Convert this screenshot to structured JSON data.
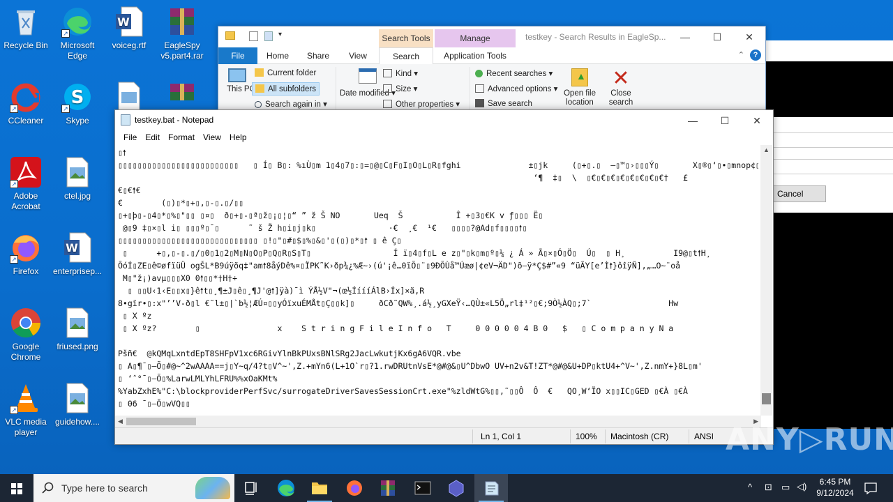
{
  "desktop_icons": [
    {
      "label": "Recycle Bin"
    },
    {
      "label": "Microsoft Edge"
    },
    {
      "label": "voiceg.rtf"
    },
    {
      "label": "EagleSpy v5.part4.rar"
    },
    {
      "label": "CCleaner"
    },
    {
      "label": "Skype"
    },
    {
      "label": "Adobe Acrobat"
    },
    {
      "label": "ctel.jpg"
    },
    {
      "label": "Firefox"
    },
    {
      "label": "enterprisep..."
    },
    {
      "label": "Google Chrome"
    },
    {
      "label": "friused.png"
    },
    {
      "label": "VLC media player"
    },
    {
      "label": "guidehow...."
    }
  ],
  "explorer": {
    "title": "testkey - Search Results in EagleSp...",
    "ctx_search_tools": "Search Tools",
    "ctx_manage": "Manage",
    "tabs": {
      "file": "File",
      "home": "Home",
      "share": "Share",
      "view": "View",
      "search": "Search",
      "app_tools": "Application Tools"
    },
    "ribbon": {
      "this_pc": "This PC",
      "current_folder": "Current folder",
      "all_subfolders": "All subfolders",
      "search_again_in": "Search again in",
      "date_modified": "Date modified",
      "kind": "Kind",
      "size": "Size",
      "other_properties": "Other properties",
      "recent_searches": "Recent searches",
      "advanced_options": "Advanced options",
      "save_search": "Save search",
      "open_file_location": "Open file location",
      "close_search": "Close search"
    }
  },
  "dialog": {
    "cancel": "Cancel"
  },
  "notepad": {
    "title": "testkey.bat - Notepad",
    "menu": [
      "File",
      "Edit",
      "Format",
      "View",
      "Help"
    ],
    "lines": [
      "▯🠕",
      "▯▯▯▯▯▯▯▯▯▯▯▯▯▯▯▯▯▯▯▯▯▯▯▯▯   ▯ Í▯ B▯: %ıÙ▯m 1▯4▯7▯:▯=▯@▯C▯F▯I▯O▯L▯R▯fghi              ±▯jk     (▯+▯.▯  –▯™▯›▯▯▯Ý▯       X▯®▯‘▯•▯mnop¢▯¤▯¦▯¨▯²▯-▯  ·▯Z",
      "                                                                                      ‘¶  ‡▯  \\  ▯€▯€▯€▯€▯€▯€▯€▯€†   £",
      "€▯€🠕€",
      "€        (▯)▯*▯+▯,▯-▯.▯/▯▯",
      "▯+▯þ▯-▯4▯*▯%▯\"▯▯ ▯¤▯  ð▯+▯-▯ª▯ž▯¡▯¦▯“ ” ž Š NO       Ueq  Š           Î +▯3▯€K v ƒ▯▯▯ Ë▯",
      " @▯9 ‡▯×▯l i▯ ▯▯▯º▯¯▯      ˜ š Ž h▯i▯j▯k▯               ·€  ¸€  ¹€   ▯▯▯▯?@Ad▯f▯▯▯▯🠕▯",
      "▯▯▯▯▯▯▯▯▯▯▯▯▯▯▯▯▯▯▯▯▯▯▯▯▯▯▯▯▯ ▯!▯\"▯#▯$▯%▯&▯'▯(▯)▯*▯🠕 ▯ ê Ç▯",
      " ▯      +▯,▯-▯.▯/▯0▯1▯2▯M▯N▯O▯P▯Q▯R▯S▯T▯                 Í ï▯4▯f▯L e z▯\"▯k▯m▯º▯¼ ¿ Á » Ã▯×▯Ó▯Ö▯  Ú▯  ▯ H¸          I9@▯t🠕H¸           ÿàH¸",
      "ÕóÍ▯ZE▯ê©øfïüÜ ogŠL*B9úÿõq‡\"am🠕8åýDê%¤▯ÏPK˜K›ðp¾¿%Æ~›(ú'¡ê…0ïÕ▯¨▯9ÐÕÙå™Úæø|¢eV¬ÄD\")õ–ÿ*Ç$#”«9 “üÃY[e’Ì🠕}ôîÿÑ],„…O~¨oå",
      " M▯\"ž¡)avµ▯▯▯X0 0🠕▯▯*†H†÷",
      "  ▯ ▯▯U‹1‹E▯▯x▯}ê🠕t▯¸¶±J▯ê▯¸¶J'@🠕]ÿà)¯ì ÝÅ½V\"¬(œ½ÍíííÁlB›Íx]×ã,R",
      "8•gïr•▯:x\"’’V-ð▯l €˜l±▯|`b½¦ÆÚ¤▯▯yÓïxuÉMÅt▯Ç▯▯k]▯     ðCð˜QW%¸.á½¸yGXeŸ‹…QÙ±«L5Ö„rl‡¹²▯€;9Ò½ÀQ▯;7`                Hw",
      " ▯ X ºz",
      " ▯ X ºz?        ▯                x    S t r i n g F i l e I n f o   T     0 0 0 0 0 4 B 0   $   ▯ C o m p a n y N a",
      "",
      "Pšñ€  @kQMqLxntdEpT8SHFpV1xc6RGivYlnBkPUxsBNlSRg2JacLwkutjKx6gA6VQR.vbe",
      "▯ A▯¶¯▯–Õ▯#@~^2wAAAA==j▯Y~q/4?t▯V^~',Z.+mYn6(L+1O`r▯?1.rwDRUtnVsE*@#@&▯U^DbwO UV+n2v&T!ZT*@#@&U+DP▯ktU4+^V~',Z.nmY+}8L▯m'",
      "▯ ‘ˆ°¯▯–Õ▯%LarwLMLYhLFRU%%xOaKMt%",
      "%YabZxhE%\"C:\\blockproviderPerfSvc/surrogateDriverSavesSessionCrt.exe\"%zldWtG%▯▯,˜▯▯Ô  Ô  €   QO¸W‘ÏO x▯▯IC▯GED ▯€À ▯€À",
      "▯ 06 ¯▯–Õ▯wVQ▯▯"
    ],
    "status": {
      "position": "Ln 1, Col 1",
      "zoom": "100%",
      "eol": "Macintosh (CR)",
      "encoding": "ANSI"
    }
  },
  "watermark": "ANY▷RUN",
  "taskbar": {
    "search_placeholder": "Type here to search",
    "time": "6:45 PM",
    "date": "9/12/2024"
  }
}
